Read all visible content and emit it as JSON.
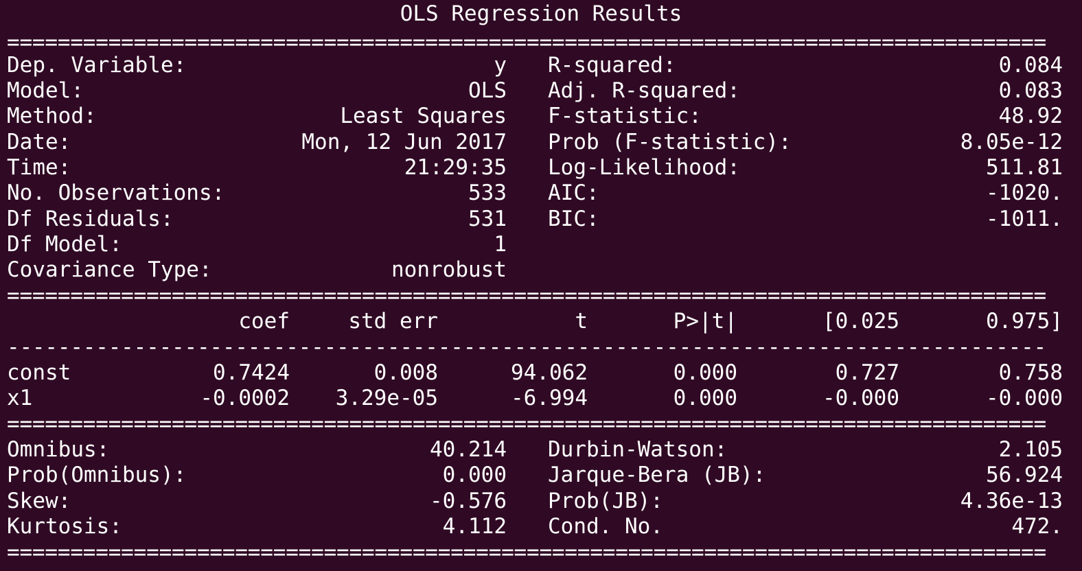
{
  "title": "OLS Regression Results",
  "rule_double": "==================================================================================",
  "rule_single": "----------------------------------------------------------------------------------",
  "model_info": [
    {
      "label": "Dep. Variable:",
      "value": "y",
      "stat_label": "R-squared:",
      "stat_value": "0.084"
    },
    {
      "label": "Model:",
      "value": "OLS",
      "stat_label": "Adj. R-squared:",
      "stat_value": "0.083"
    },
    {
      "label": "Method:",
      "value": "Least Squares",
      "stat_label": "F-statistic:",
      "stat_value": "48.92"
    },
    {
      "label": "Date:",
      "value": "Mon, 12 Jun 2017",
      "stat_label": "Prob (F-statistic):",
      "stat_value": "8.05e-12"
    },
    {
      "label": "Time:",
      "value": "21:29:35",
      "stat_label": "Log-Likelihood:",
      "stat_value": "511.81"
    },
    {
      "label": "No. Observations:",
      "value": "533",
      "stat_label": "AIC:",
      "stat_value": "-1020."
    },
    {
      "label": "Df Residuals:",
      "value": "531",
      "stat_label": "BIC:",
      "stat_value": "-1011."
    },
    {
      "label": "Df Model:",
      "value": "1",
      "stat_label": "",
      "stat_value": ""
    },
    {
      "label": "Covariance Type:",
      "value": "nonrobust",
      "stat_label": "",
      "stat_value": ""
    }
  ],
  "coef_table": {
    "headers": [
      "coef",
      "std err",
      "t",
      "P>|t|",
      "[0.025",
      "0.975]"
    ],
    "rows": [
      {
        "name": "const",
        "values": [
          "0.7424",
          "0.008",
          "94.062",
          "0.000",
          "0.727",
          "0.758"
        ]
      },
      {
        "name": "x1",
        "values": [
          "-0.0002",
          "3.29e-05",
          "-6.994",
          "0.000",
          "-0.000",
          "-0.000"
        ]
      }
    ]
  },
  "diagnostics": [
    {
      "label": "Omnibus:",
      "value": "40.214",
      "stat_label": "Durbin-Watson:",
      "stat_value": "2.105"
    },
    {
      "label": "Prob(Omnibus):",
      "value": "0.000",
      "stat_label": "Jarque-Bera (JB):",
      "stat_value": "56.924"
    },
    {
      "label": "Skew:",
      "value": "-0.576",
      "stat_label": "Prob(JB):",
      "stat_value": "4.36e-13"
    },
    {
      "label": "Kurtosis:",
      "value": "4.112",
      "stat_label": "Cond. No.",
      "stat_value": "472."
    }
  ]
}
